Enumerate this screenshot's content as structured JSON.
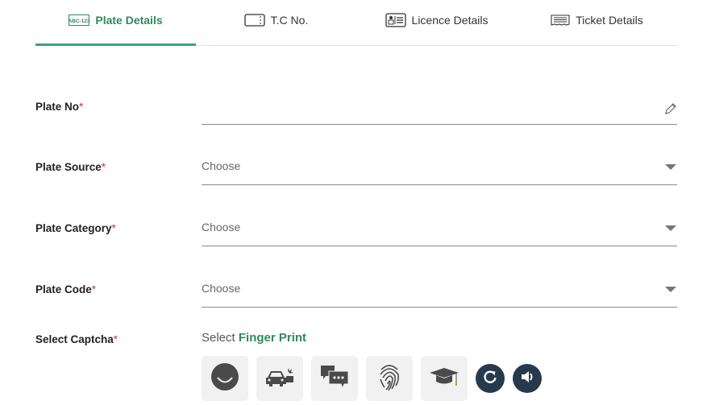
{
  "tabs": [
    {
      "label": "Plate Details",
      "icon": "plate-icon",
      "active": true
    },
    {
      "label": "T.C No.",
      "icon": "ticket-card-icon",
      "active": false
    },
    {
      "label": "Licence Details",
      "icon": "licence-card-icon",
      "active": false
    },
    {
      "label": "Ticket Details",
      "icon": "receipt-icon",
      "active": false
    }
  ],
  "plate_icon_text": "ABC-123",
  "form": {
    "plate_no": {
      "label": "Plate No",
      "required": "*",
      "value": ""
    },
    "plate_source": {
      "label": "Plate Source",
      "required": "*",
      "value": "Choose"
    },
    "plate_category": {
      "label": "Plate Category",
      "required": "*",
      "value": "Choose"
    },
    "plate_code": {
      "label": "Plate Code",
      "required": "*",
      "value": "Choose"
    },
    "captcha": {
      "label": "Select Captcha",
      "required": "*",
      "prompt_prefix": "Select",
      "prompt_target": "Finger Print",
      "options": [
        "smiley-icon",
        "car-crash-icon",
        "chat-bubbles-icon",
        "fingerprint-icon",
        "graduation-cap-icon"
      ],
      "refresh": "refresh-icon",
      "audio": "speaker-icon"
    }
  },
  "colors": {
    "accent": "#2e8a5c",
    "required": "#c0392b",
    "dark_button": "#27394d"
  }
}
